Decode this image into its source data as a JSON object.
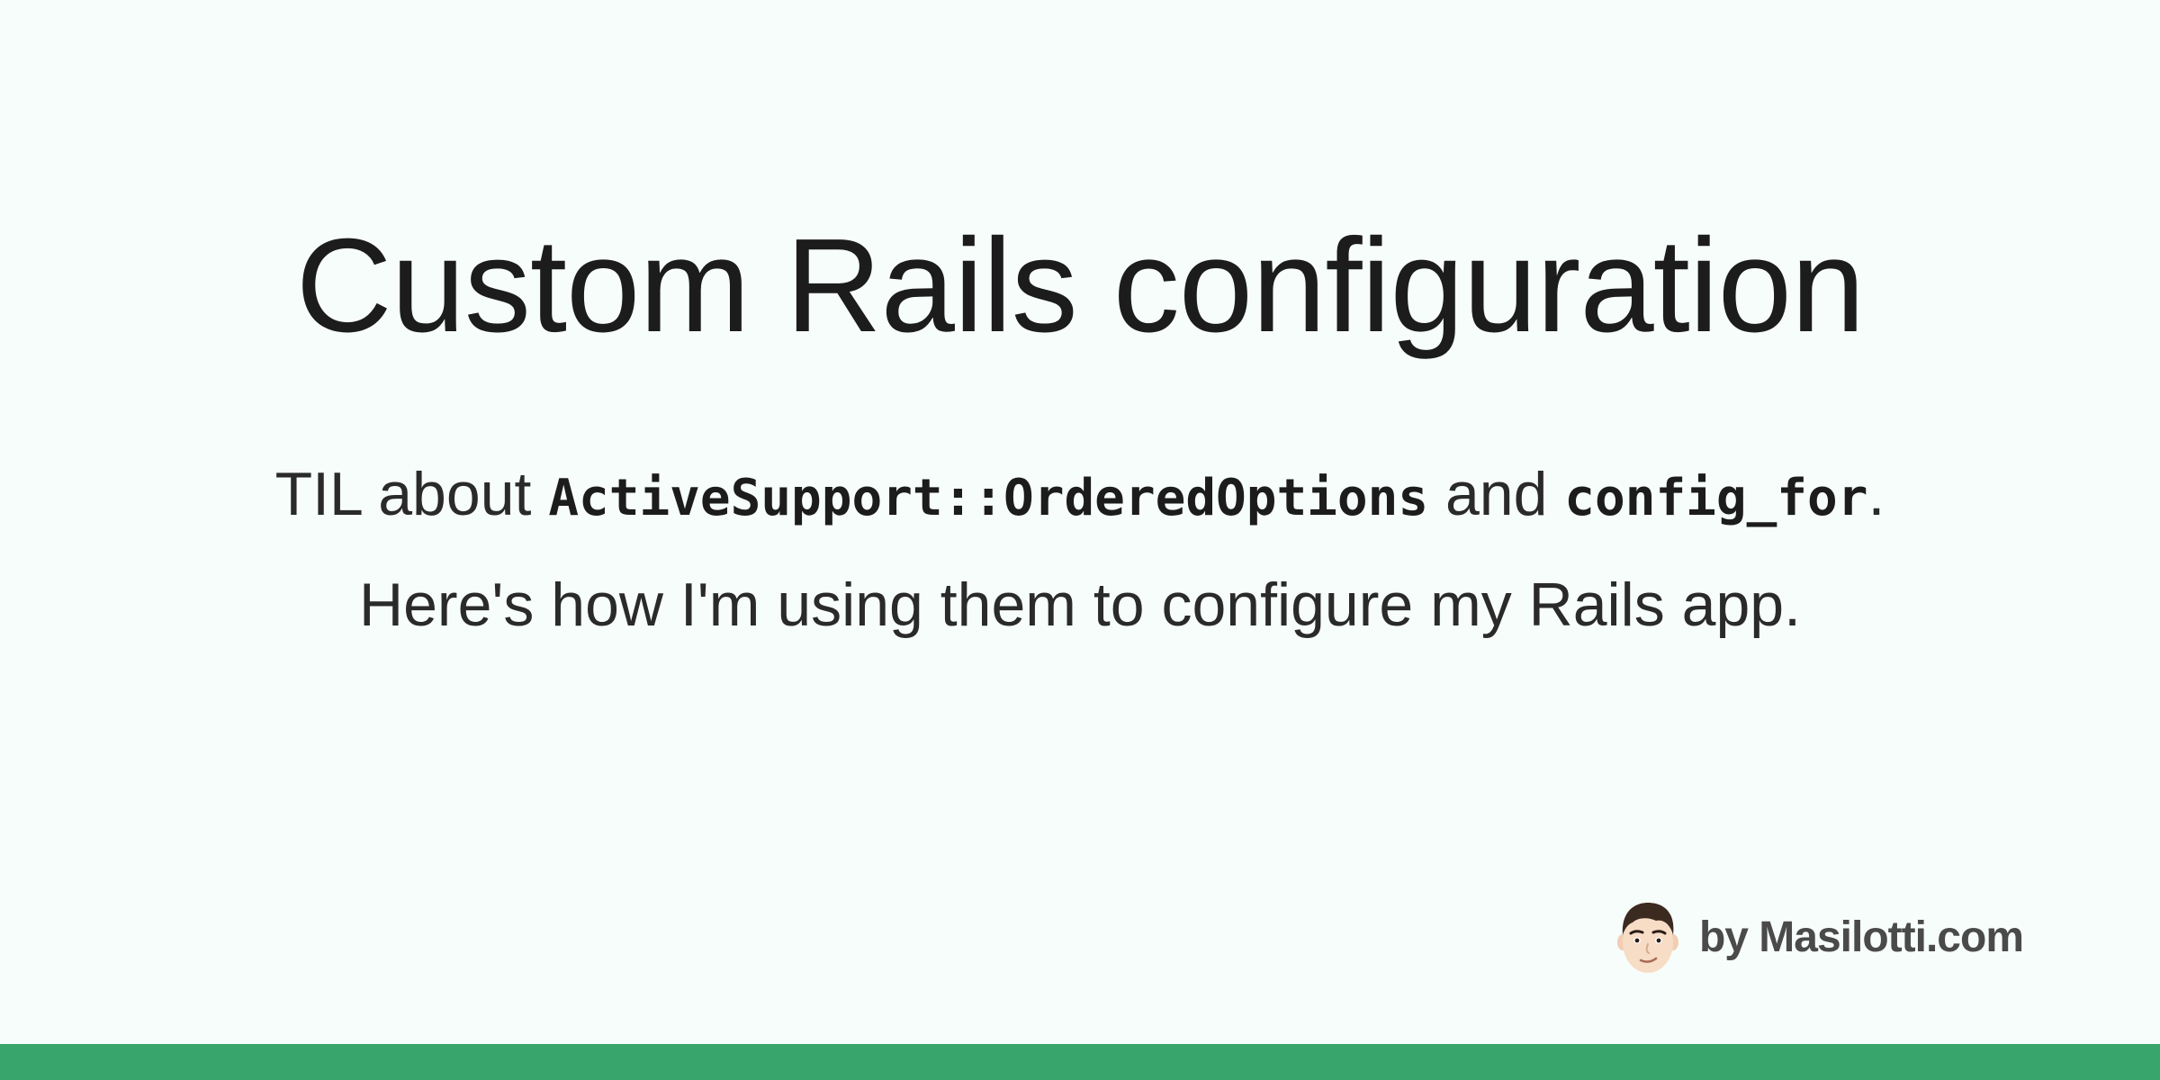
{
  "title": "Custom Rails configuration",
  "subtitle": {
    "line1": {
      "prefix": "TIL about ",
      "code1": "ActiveSupport::OrderedOptions",
      "middle": " and ",
      "code2": "config_for",
      "suffix": "."
    },
    "line2": "Here's how I'm using them to configure my Rails app."
  },
  "byline": {
    "text": "by Masilotti.com",
    "avatar_icon": "memoji-avatar"
  },
  "colors": {
    "background": "#f7fdfa",
    "accent_bar": "#37a56c",
    "title": "#1c1c1c",
    "byline": "#4a4a4a"
  }
}
